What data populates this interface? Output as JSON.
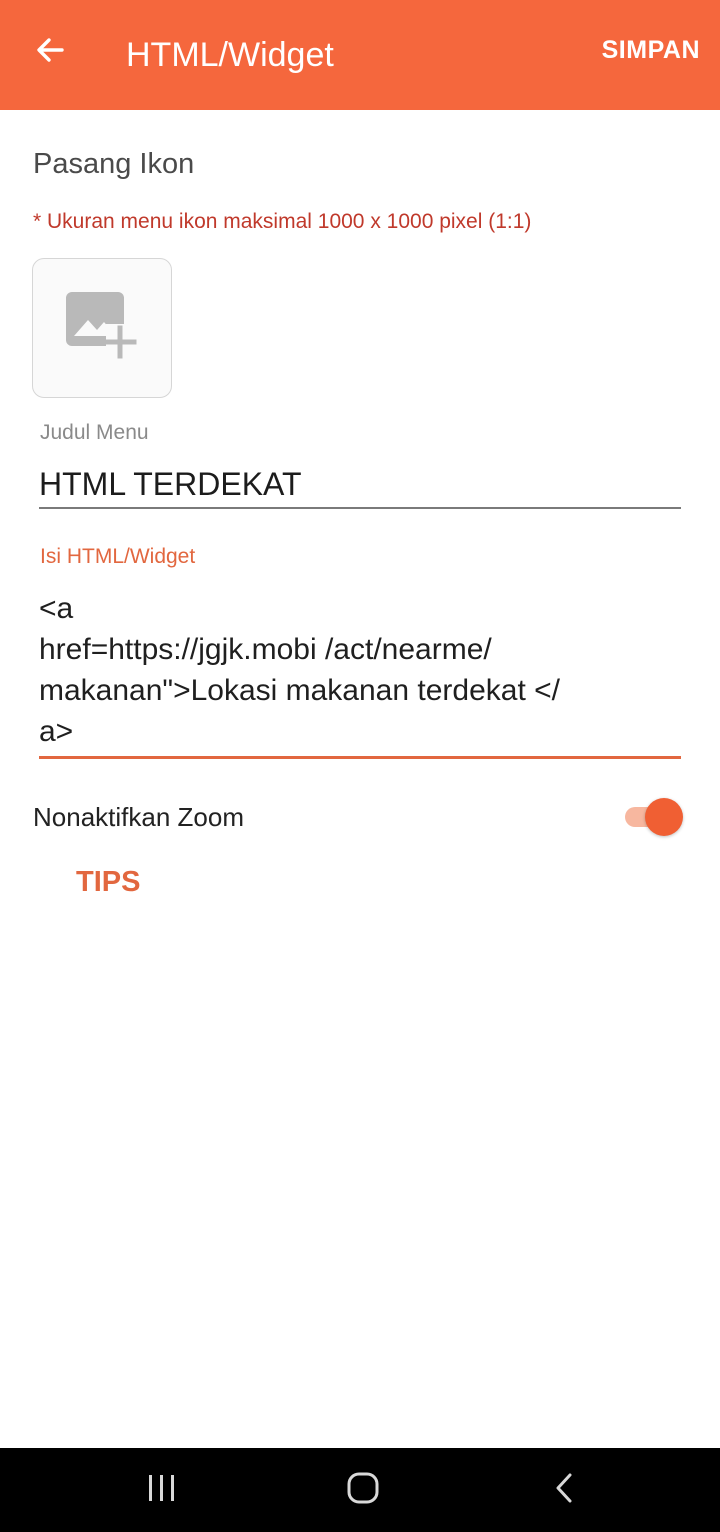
{
  "app_bar": {
    "title": "HTML/Widget",
    "save_label": "SIMPAN",
    "back_icon": "arrow-left-icon",
    "color": "#f5673d"
  },
  "icon_section": {
    "title": "Pasang Ikon",
    "hint": "* Ukuran menu ikon maksimal 1000 x 1000 pixel (1:1)",
    "picker_icon": "add-photo-icon"
  },
  "menu_title": {
    "label": "Judul Menu",
    "value": "HTML TERDEKAT"
  },
  "html_widget": {
    "label": "Isi HTML/Widget",
    "value": "<a\nhref=https://jgjk.mobi /act/nearme/\nmakanan\">Lokasi makanan terdekat </\na>"
  },
  "zoom": {
    "label": "Nonaktifkan Zoom",
    "enabled": true
  },
  "tips_label": "TIPS",
  "system_nav": {
    "recents_icon": "recents-icon",
    "home_icon": "home-icon",
    "back_icon": "back-chevron-icon"
  },
  "colors": {
    "accent": "#e2673f",
    "hint_red": "#c0392b"
  }
}
